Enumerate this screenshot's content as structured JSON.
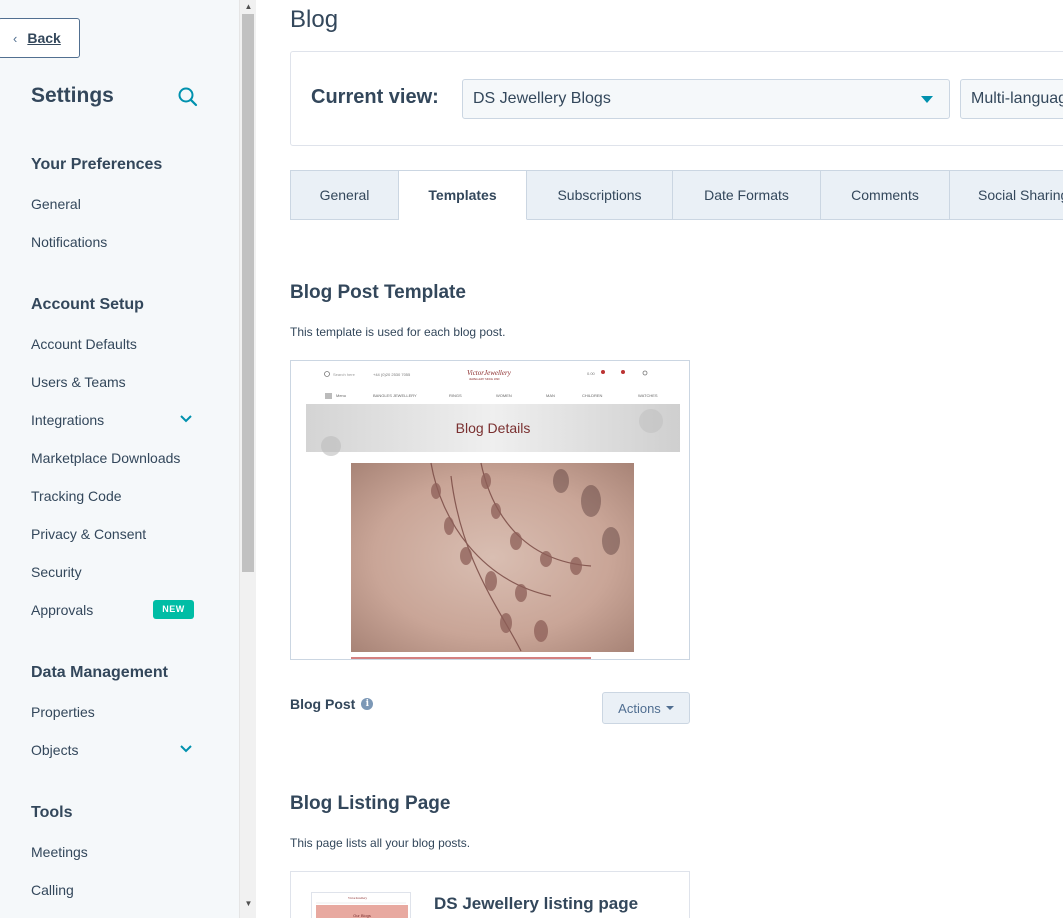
{
  "sidebar": {
    "back_label": "Back",
    "title": "Settings",
    "sections": [
      {
        "heading": "Your Preferences",
        "items": [
          {
            "label": "General"
          },
          {
            "label": "Notifications"
          }
        ]
      },
      {
        "heading": "Account Setup",
        "items": [
          {
            "label": "Account Defaults"
          },
          {
            "label": "Users & Teams"
          },
          {
            "label": "Integrations",
            "expandable": true
          },
          {
            "label": "Marketplace Downloads"
          },
          {
            "label": "Tracking Code"
          },
          {
            "label": "Privacy & Consent"
          },
          {
            "label": "Security"
          },
          {
            "label": "Approvals",
            "badge": "NEW"
          }
        ]
      },
      {
        "heading": "Data Management",
        "items": [
          {
            "label": "Properties"
          },
          {
            "label": "Objects",
            "expandable": true
          }
        ]
      },
      {
        "heading": "Tools",
        "items": [
          {
            "label": "Meetings"
          },
          {
            "label": "Calling"
          }
        ]
      }
    ]
  },
  "main": {
    "title": "Blog",
    "current_view": {
      "label": "Current view:",
      "selected": "DS Jewellery Blogs",
      "language": "Multi-language"
    },
    "tabs": [
      {
        "label": "General"
      },
      {
        "label": "Templates",
        "active": true
      },
      {
        "label": "Subscriptions"
      },
      {
        "label": "Date Formats"
      },
      {
        "label": "Comments"
      },
      {
        "label": "Social Sharing"
      }
    ],
    "post_template": {
      "title": "Blog Post Template",
      "description": "This template is used for each blog post.",
      "name": "Blog Post",
      "actions_label": "Actions",
      "preview": {
        "search": "Search here",
        "phone": "+44 (0)20 2530 7055",
        "logo": "VictorJewellery",
        "logo_tag": "JEWELLERY SINCE 1990",
        "cart": "0.00",
        "nav": [
          "Menu",
          "BANGLES JEWELLERY",
          "RINGS",
          "WOMEN",
          "MAN",
          "CHILDREN",
          "WATCHES"
        ],
        "banner": "Blog Details"
      }
    },
    "listing": {
      "title": "Blog Listing Page",
      "description": "This page lists all your blog posts.",
      "name": "DS Jewellery listing page",
      "thumb_text": "Our Blogs"
    }
  },
  "colors": {
    "accent": "#0091ae",
    "badge": "#00bda5",
    "text": "#33475b",
    "sidebar_bg": "#f5f8fa"
  }
}
